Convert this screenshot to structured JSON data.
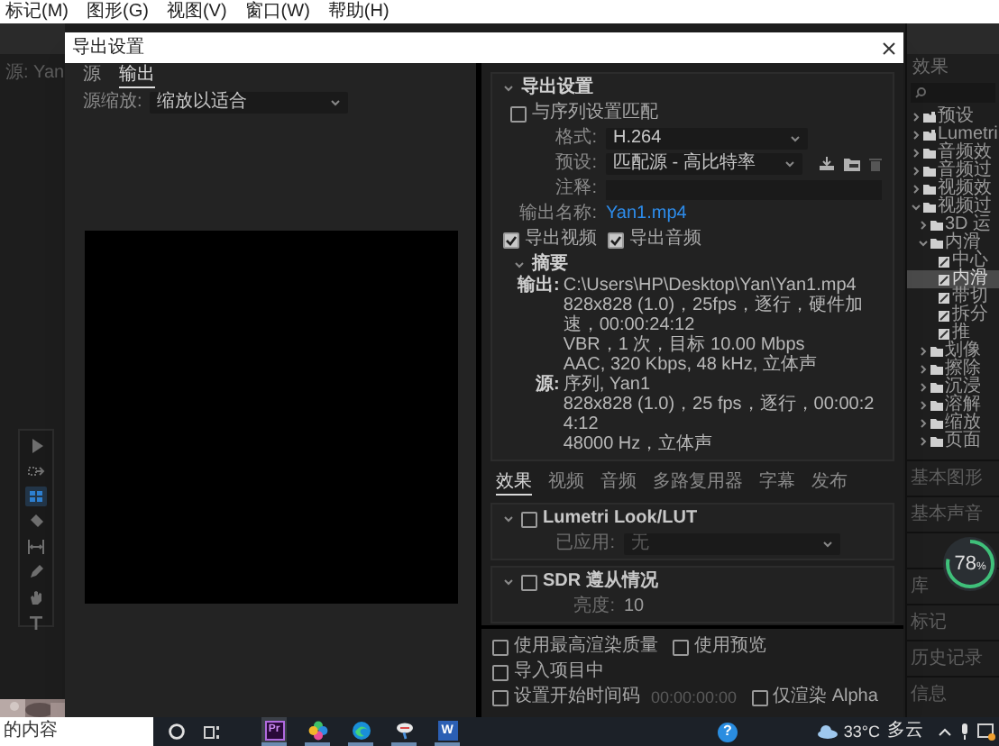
{
  "menu_bar": [
    {
      "label": "标记(M)"
    },
    {
      "label": "图形(G)"
    },
    {
      "label": "视图(V)"
    },
    {
      "label": "窗口(W)"
    },
    {
      "label": "帮助(H)"
    }
  ],
  "source_monitor": {
    "title": "源: Yan"
  },
  "tools": [
    {
      "kind": "select",
      "selected": false
    },
    {
      "kind": "track-select",
      "selected": false
    },
    {
      "kind": "ripple",
      "selected": true
    },
    {
      "kind": "razor",
      "selected": false
    },
    {
      "kind": "slip",
      "selected": false
    },
    {
      "kind": "pen",
      "selected": false
    },
    {
      "kind": "hand",
      "selected": false
    },
    {
      "kind": "type",
      "selected": false
    }
  ],
  "effects_panel": {
    "title": "效果",
    "tree": [
      {
        "label": "预设",
        "kind": "preset-folder",
        "expanded": false,
        "selected": false
      },
      {
        "label": "Lumetri",
        "kind": "preset-folder",
        "expanded": false,
        "selected": false
      },
      {
        "label": "音频效",
        "kind": "folder",
        "expanded": false,
        "selected": false
      },
      {
        "label": "音频过",
        "kind": "folder",
        "expanded": false,
        "selected": false
      },
      {
        "label": "视频效",
        "kind": "folder",
        "expanded": false,
        "selected": false
      },
      {
        "label": "视频过",
        "kind": "folder",
        "expanded": true,
        "selected": false,
        "children": [
          {
            "label": "3D 运",
            "kind": "folder",
            "expanded": false,
            "selected": false
          },
          {
            "label": "内滑",
            "kind": "folder",
            "expanded": true,
            "selected": false,
            "children": [
              {
                "label": "中心",
                "kind": "effect",
                "selected": false
              },
              {
                "label": "内滑",
                "kind": "effect",
                "selected": true
              },
              {
                "label": "带切",
                "kind": "effect",
                "selected": false
              },
              {
                "label": "拆分",
                "kind": "effect",
                "selected": false
              },
              {
                "label": "推",
                "kind": "effect",
                "selected": false
              }
            ]
          },
          {
            "label": "划像",
            "kind": "folder",
            "expanded": false,
            "selected": false
          },
          {
            "label": "擦除",
            "kind": "folder",
            "expanded": false,
            "selected": false
          },
          {
            "label": "沉浸",
            "kind": "folder",
            "expanded": false,
            "selected": false
          },
          {
            "label": "溶解",
            "kind": "folder",
            "expanded": false,
            "selected": false
          },
          {
            "label": "缩放",
            "kind": "folder",
            "expanded": false,
            "selected": false
          },
          {
            "label": "页面",
            "kind": "folder",
            "expanded": false,
            "selected": false
          }
        ]
      }
    ]
  },
  "panels": [
    {
      "label": "基本图形"
    },
    {
      "label": "基本声音"
    },
    {
      "label": "库"
    },
    {
      "label": "标记"
    },
    {
      "label": "历史记录"
    },
    {
      "label": "信息"
    }
  ],
  "dialog": {
    "title": "导出设置",
    "tabs": [
      {
        "label": "源",
        "selected": false
      },
      {
        "label": "输出",
        "selected": true
      }
    ],
    "source_scaling": {
      "label": "源缩放:",
      "value": "缩放以适合"
    },
    "export_settings": {
      "title": "导出设置",
      "expanded": true,
      "match_sequence": {
        "label": "与序列设置匹配",
        "checked": false
      },
      "format": {
        "label": "格式:",
        "value": "H.264"
      },
      "preset": {
        "label": "预设:",
        "value": "匹配源 - 高比特率"
      },
      "comments": {
        "label": "注释:"
      },
      "output_name": {
        "label": "输出名称:",
        "value": "Yan1.mp4"
      },
      "export_video": {
        "label": "导出视频",
        "checked": true
      },
      "export_audio": {
        "label": "导出音频",
        "checked": true
      },
      "summary": {
        "title": "摘要",
        "expanded": true,
        "output": {
          "label": "输出:",
          "lines": [
            "C:\\Users\\HP\\Desktop\\Yan\\Yan1.mp4",
            "828x828 (1.0)，25fps，逐行，硬件加速，00:00:24:12",
            "VBR，1 次，目标 10.00 Mbps",
            "AAC, 320 Kbps, 48 kHz, 立体声"
          ]
        },
        "source": {
          "label": "源:",
          "lines": [
            "序列, Yan1",
            "828x828 (1.0)，25 fps，逐行，00:00:24:12",
            "48000 Hz，立体声"
          ]
        }
      }
    },
    "settings_tabs": [
      {
        "label": "效果",
        "selected": true
      },
      {
        "label": "视频",
        "selected": false
      },
      {
        "label": "音频",
        "selected": false
      },
      {
        "label": "多路复用器",
        "selected": false
      },
      {
        "label": "字幕",
        "selected": false
      },
      {
        "label": "发布",
        "selected": false
      }
    ],
    "effects": [
      {
        "label": "Lumetri Look/LUT",
        "checked": false,
        "expanded": true,
        "field": {
          "kind": "dropdown",
          "label": "已应用:",
          "value": "无"
        }
      },
      {
        "label": "SDR 遵从情况",
        "checked": false,
        "expanded": true,
        "field": {
          "kind": "value",
          "label": "亮度:",
          "value": "10"
        }
      }
    ],
    "options": [
      [
        {
          "label": "使用最高渲染质量",
          "checked": false
        },
        {
          "label": "使用预览",
          "checked": false
        }
      ],
      [
        {
          "label": "导入项目中",
          "checked": false
        }
      ],
      [
        {
          "label": "设置开始时间码",
          "checked": false,
          "value": "00:00:00:00"
        },
        {
          "label": "仅渲染 Alpha",
          "checked": false
        }
      ]
    ]
  },
  "performance_widget": {
    "value": "78",
    "unit": "%",
    "level": 0.78
  },
  "taskbar": {
    "search": {
      "value": "的内容"
    },
    "apps": [
      {
        "kind": "premiere",
        "label": "Pr",
        "selected": true
      },
      {
        "kind": "photos",
        "selected": false
      },
      {
        "kind": "edge",
        "selected": false
      },
      {
        "kind": "paint",
        "selected": false
      },
      {
        "kind": "word",
        "label": "W",
        "selected": false
      }
    ],
    "help": "?",
    "weather": {
      "temperature": "33°C",
      "condition": "多云"
    }
  }
}
